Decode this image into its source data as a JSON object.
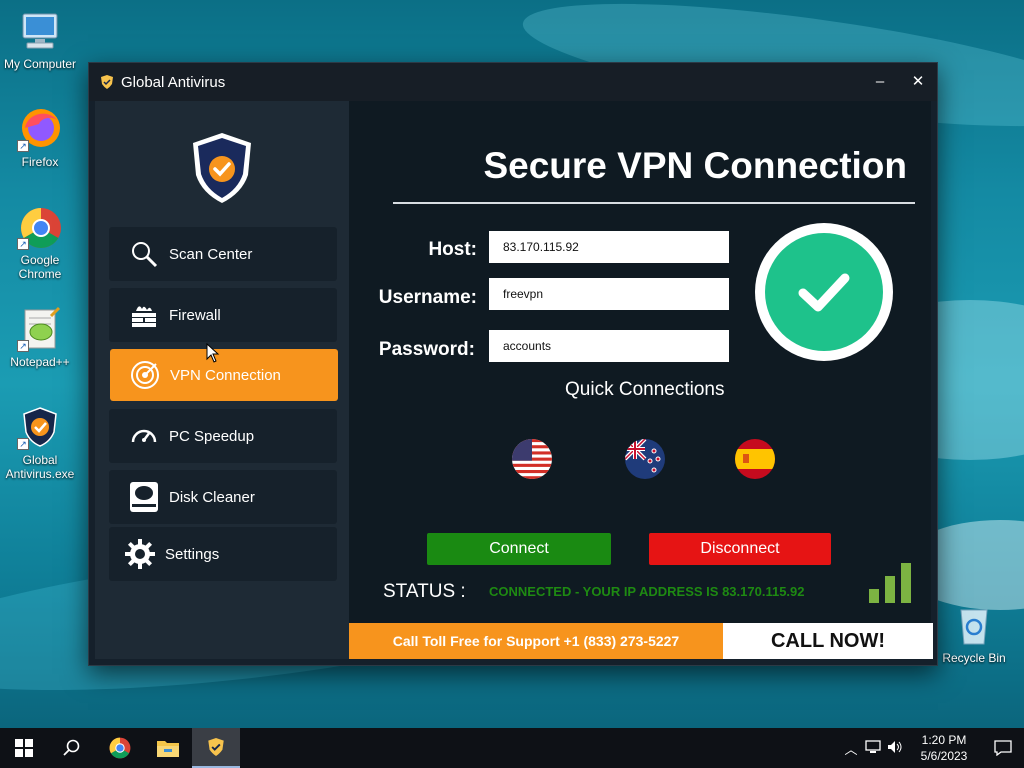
{
  "desktop": {
    "icons": [
      {
        "label": "My Computer"
      },
      {
        "label": "Firefox"
      },
      {
        "label": "Google Chrome"
      },
      {
        "label": "Notepad++"
      },
      {
        "label": "Global Antivirus.exe"
      },
      {
        "label": "Recycle Bin"
      }
    ]
  },
  "window": {
    "title": "Global Antivirus",
    "minimize_label": "–",
    "close_label": "✕"
  },
  "sidebar": {
    "items": [
      {
        "label": "Scan Center",
        "icon": "magnifier-icon"
      },
      {
        "label": "Firewall",
        "icon": "firewall-icon"
      },
      {
        "label": "VPN Connection",
        "icon": "vpn-target-icon",
        "active": true
      },
      {
        "label": "PC Speedup",
        "icon": "speedometer-icon"
      },
      {
        "label": "Disk Cleaner",
        "icon": "disk-icon"
      },
      {
        "label": "Settings",
        "icon": "gear-icon"
      }
    ]
  },
  "main": {
    "heading": "Secure VPN Connection",
    "fields": {
      "host": {
        "label": "Host:",
        "value": "83.170.115.92"
      },
      "username": {
        "label": "Username:",
        "value": "freevpn"
      },
      "password": {
        "label": "Password:",
        "value": "accounts"
      }
    },
    "quick_connections_label": "Quick Connections",
    "flags": [
      "united-states-flag-icon",
      "new-zealand-flag-icon",
      "spain-flag-icon"
    ],
    "connect_label": "Connect",
    "disconnect_label": "Disconnect",
    "status_label": "STATUS :",
    "status_text": "CONNECTED - YOUR IP ADDRESS IS  83.170.115.92",
    "support_text": "Call Toll Free for Support +1 (833) 273-5227",
    "call_now_label": "CALL NOW!"
  },
  "colors": {
    "accent_orange": "#f7941d",
    "connect_green": "#1a8a12",
    "disconnect_red": "#e61414",
    "check_green": "#1ec28b",
    "status_green": "#1e8a12"
  },
  "taskbar": {
    "time": "1:20 PM",
    "date": "5/6/2023"
  }
}
